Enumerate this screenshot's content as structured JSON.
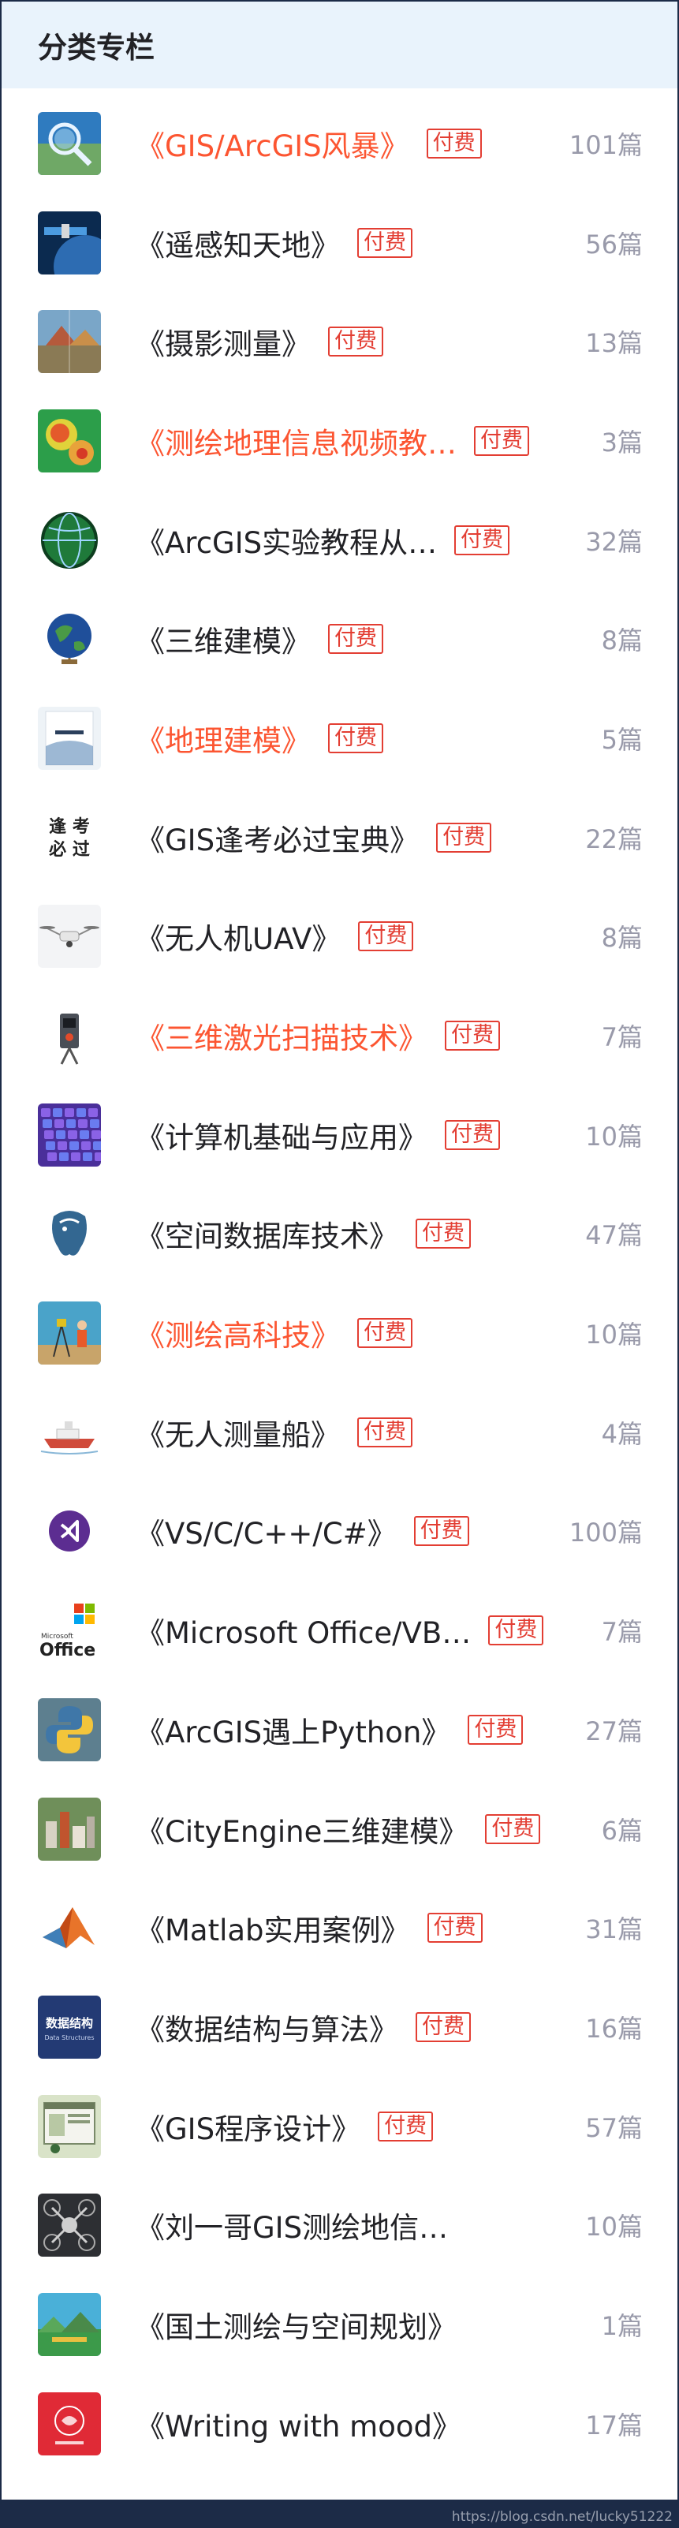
{
  "header": {
    "title": "分类专栏"
  },
  "badge_label": "付费",
  "items": [
    {
      "title": "《GIS/ArcGIS风暴》",
      "count": "101篇",
      "paid": true,
      "hot": true,
      "icon": "gis-lens-icon"
    },
    {
      "title": "《遥感知天地》",
      "count": "56篇",
      "paid": true,
      "hot": false,
      "icon": "satellite-icon"
    },
    {
      "title": "《摄影测量》",
      "count": "13篇",
      "paid": true,
      "hot": false,
      "icon": "photogrammetry-icon"
    },
    {
      "title": "《测绘地理信息视频教…",
      "count": "3篇",
      "paid": true,
      "hot": true,
      "icon": "terrain-map-icon"
    },
    {
      "title": "《ArcGIS实验教程从…",
      "count": "32篇",
      "paid": true,
      "hot": false,
      "icon": "arcgis-globe-icon"
    },
    {
      "title": "《三维建模》",
      "count": "8篇",
      "paid": true,
      "hot": false,
      "icon": "globe-icon"
    },
    {
      "title": "《地理建模》",
      "count": "5篇",
      "paid": true,
      "hot": true,
      "icon": "book-cover-icon"
    },
    {
      "title": "《GIS逢考必过宝典》",
      "count": "22篇",
      "paid": true,
      "hot": false,
      "icon": "exam-text-icon"
    },
    {
      "title": "《无人机UAV》",
      "count": "8篇",
      "paid": true,
      "hot": false,
      "icon": "drone-icon"
    },
    {
      "title": "《三维激光扫描技术》",
      "count": "7篇",
      "paid": true,
      "hot": true,
      "icon": "laser-scanner-icon"
    },
    {
      "title": "《计算机基础与应用》",
      "count": "10篇",
      "paid": true,
      "hot": false,
      "icon": "keyboard-icon"
    },
    {
      "title": "《空间数据库技术》",
      "count": "47篇",
      "paid": true,
      "hot": false,
      "icon": "postgresql-icon"
    },
    {
      "title": "《测绘高科技》",
      "count": "10篇",
      "paid": true,
      "hot": true,
      "icon": "surveyor-icon"
    },
    {
      "title": "《无人测量船》",
      "count": "4篇",
      "paid": true,
      "hot": false,
      "icon": "boat-icon"
    },
    {
      "title": "《VS/C/C++/C#》",
      "count": "100篇",
      "paid": true,
      "hot": false,
      "icon": "visual-studio-icon"
    },
    {
      "title": "《Microsoft Office/VB…",
      "count": "7篇",
      "paid": true,
      "hot": false,
      "icon": "office-logo-icon"
    },
    {
      "title": "《ArcGIS遇上Python》",
      "count": "27篇",
      "paid": true,
      "hot": false,
      "icon": "python-icon"
    },
    {
      "title": "《CityEngine三维建模》",
      "count": "6篇",
      "paid": true,
      "hot": false,
      "icon": "city-model-icon"
    },
    {
      "title": "《Matlab实用案例》",
      "count": "31篇",
      "paid": true,
      "hot": false,
      "icon": "matlab-icon"
    },
    {
      "title": "《数据结构与算法》",
      "count": "16篇",
      "paid": true,
      "hot": false,
      "icon": "data-structures-icon"
    },
    {
      "title": "《GIS程序设计》",
      "count": "57篇",
      "paid": true,
      "hot": false,
      "icon": "software-window-icon"
    },
    {
      "title": "《刘一哥GIS测绘地信…",
      "count": "10篇",
      "paid": false,
      "hot": false,
      "icon": "drone-top-icon"
    },
    {
      "title": "《国土测绘与空间规划》",
      "count": "1篇",
      "paid": false,
      "hot": false,
      "icon": "landscape-icon"
    },
    {
      "title": "《Writing with mood》",
      "count": "17篇",
      "paid": false,
      "hot": false,
      "icon": "red-book-icon"
    }
  ],
  "thumb_text": {
    "exam_line1": "逢 考",
    "exam_line2": "必 过",
    "office_small": "Microsoft",
    "office_big": "Office",
    "ds_line1": "数据结构",
    "ds_line2": "Data Structures"
  },
  "watermark": "https://blog.csdn.net/lucky51222"
}
